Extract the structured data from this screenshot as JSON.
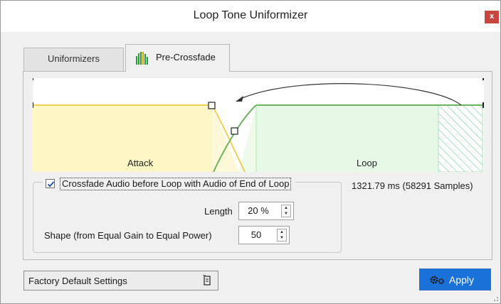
{
  "window": {
    "title": "Loop Tone Uniformizer",
    "close_label": "x"
  },
  "tabs": [
    {
      "label": "Uniformizers",
      "active": false
    },
    {
      "label": "Pre-Crossfade",
      "active": true,
      "icon": "level-meter-icon"
    }
  ],
  "graph": {
    "attack_label": "Attack",
    "loop_label": "Loop",
    "colors": {
      "attack": "#fdf7c6",
      "loop": "#e6f9e6",
      "curve_attack": "#f2cf52",
      "curve_loop": "#6ab55e"
    }
  },
  "crossfade": {
    "checkbox_label": "Crossfade Audio before Loop with Audio of End of Loop",
    "checked": true,
    "info": "1321.79 ms (58291 Samples)",
    "length_label": "Length",
    "length_value": "20 %",
    "shape_label": "Shape (from Equal Gain to Equal Power)",
    "shape_value": "50"
  },
  "footer": {
    "preset_label": "Factory Default Settings",
    "apply_label": "Apply",
    "apply_color": "#1a72d8"
  }
}
